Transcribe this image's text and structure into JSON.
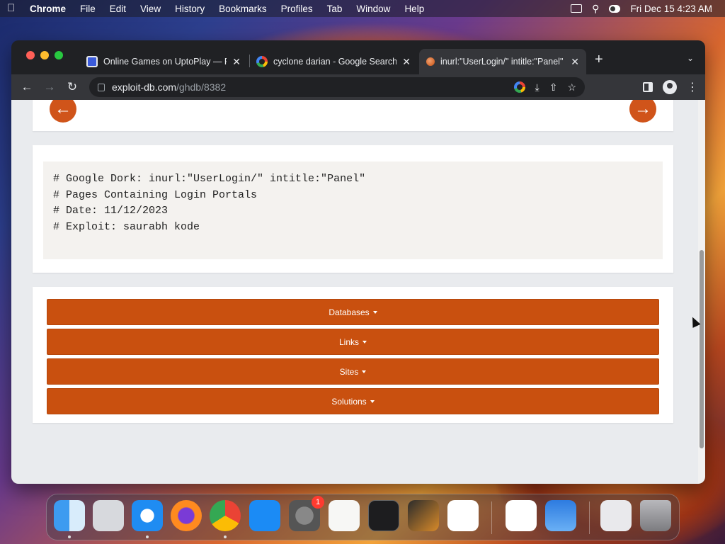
{
  "menubar": {
    "app_name": "Chrome",
    "items": [
      "File",
      "Edit",
      "View",
      "History",
      "Bookmarks",
      "Profiles",
      "Tab",
      "Window",
      "Help"
    ],
    "clock": "Fri Dec 15  4:23 AM"
  },
  "browser": {
    "tabs": [
      {
        "title": "Online Games on UptoPlay — P",
        "favicon": "uptoplay-icon",
        "close": "✕"
      },
      {
        "title": "cyclone darian - Google Search",
        "favicon": "google-icon",
        "close": "✕"
      },
      {
        "title": "inurl:\"UserLogin/\" intitle:\"Panel\"",
        "favicon": "exploit-db-icon",
        "close": "✕"
      }
    ],
    "new_tab": "+",
    "url_host": "exploit-db.com",
    "url_path": "/ghdb/8382"
  },
  "page": {
    "code_lines": [
      "# Google Dork: inurl:\"UserLogin/\" intitle:\"Panel\"",
      "# Pages Containing Login Portals",
      "# Date: 11/12/2023",
      "# Exploit: saurabh kode"
    ],
    "dropdowns": [
      "Databases",
      "Links",
      "Sites",
      "Solutions"
    ],
    "prev_arrow": "←",
    "next_arrow": "→"
  },
  "dock": {
    "apps": [
      "Finder",
      "Launchpad",
      "Safari",
      "Firefox",
      "Chrome",
      "App Store",
      "System Preferences",
      "TextEdit",
      "Terminal",
      "GarageBand",
      "Visual Studio Code",
      "Visual Studio",
      "Weather",
      "Preview",
      "Trash"
    ],
    "system_prefs_badge": "1"
  },
  "colors": {
    "accent": "#c9500f",
    "arrow": "#d0541a",
    "code_bg": "#f4f2ef"
  }
}
